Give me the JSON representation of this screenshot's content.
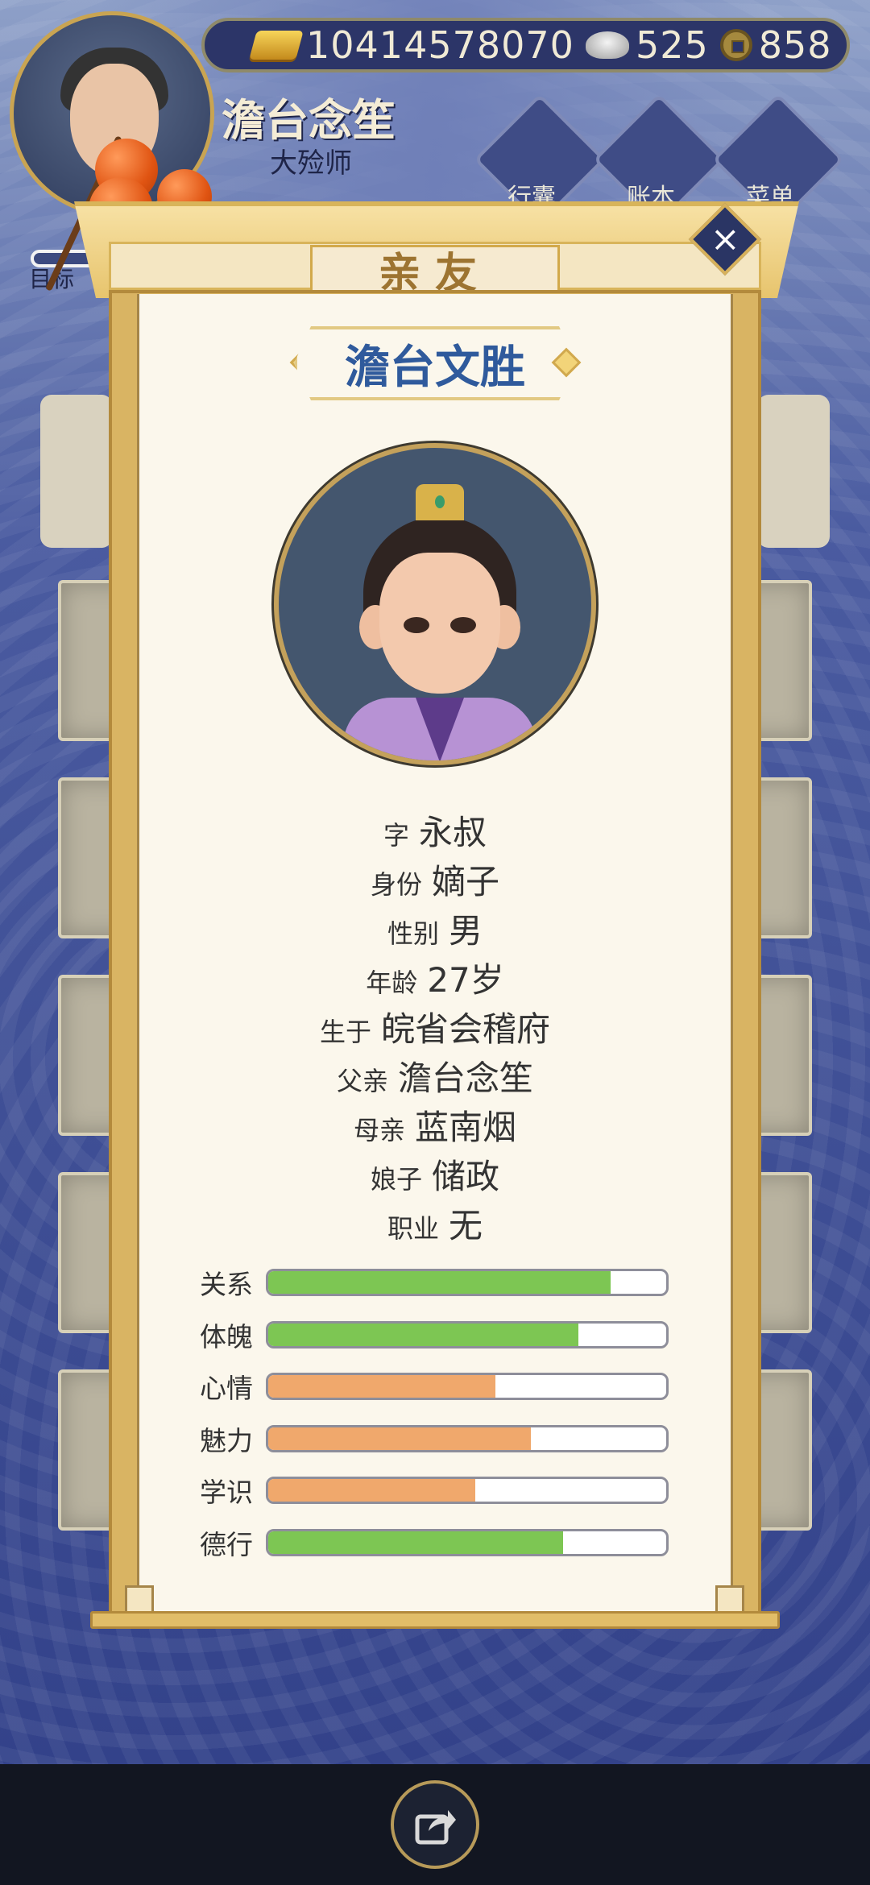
{
  "header": {
    "player_name": "澹台念笙",
    "player_title": "大殓师",
    "target_label": "目标",
    "currency": [
      {
        "icon": "gold-ingot-icon",
        "value": "10414578070"
      },
      {
        "icon": "silver-ingot-icon",
        "value": "525"
      },
      {
        "icon": "copper-coin-icon",
        "value": "858"
      }
    ],
    "buttons": [
      {
        "label": "行囊",
        "icon": "bag-icon"
      },
      {
        "label": "账本",
        "icon": "book-icon"
      },
      {
        "label": "菜单",
        "icon": "menu-dots-icon"
      }
    ]
  },
  "modal": {
    "title": "亲友",
    "character_name": "澹台文胜",
    "info": [
      {
        "label": "字",
        "value": "永叔"
      },
      {
        "label": "身份",
        "value": "嫡子"
      },
      {
        "label": "性别",
        "value": "男"
      },
      {
        "label": "年龄",
        "value": "27岁"
      },
      {
        "label": "生于",
        "value": "皖省会稽府"
      },
      {
        "label": "父亲",
        "value": "澹台念笙"
      },
      {
        "label": "母亲",
        "value": "蓝南烟"
      },
      {
        "label": "娘子",
        "value": "储政"
      },
      {
        "label": "职业",
        "value": "无"
      }
    ],
    "stats": [
      {
        "label": "关系",
        "fraction": 0.86,
        "color": "#7dc653"
      },
      {
        "label": "体魄",
        "fraction": 0.78,
        "color": "#7dc653"
      },
      {
        "label": "心情",
        "fraction": 0.57,
        "color": "#f0a86c"
      },
      {
        "label": "魅力",
        "fraction": 0.66,
        "color": "#f0a86c"
      },
      {
        "label": "学识",
        "fraction": 0.52,
        "color": "#f0a86c"
      },
      {
        "label": "德行",
        "fraction": 0.74,
        "color": "#7dc653"
      }
    ]
  },
  "footer": {
    "share_icon": "share-icon"
  }
}
